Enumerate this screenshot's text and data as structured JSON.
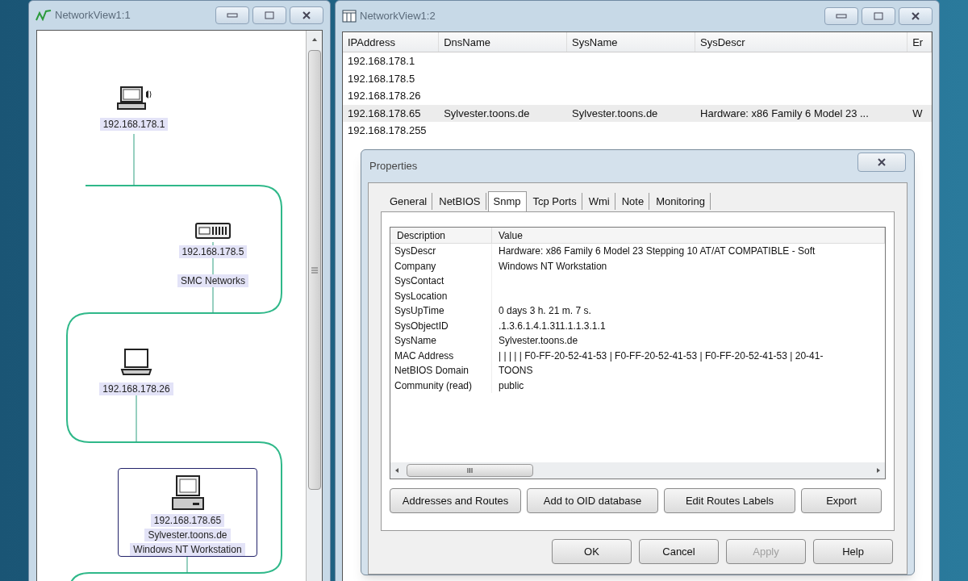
{
  "topology_window": {
    "title": "NetworkView1:1",
    "nodes": [
      {
        "kind": "workstation",
        "labels": [
          "192.168.178.1"
        ],
        "selected": false
      },
      {
        "kind": "router",
        "labels": [
          "192.168.178.5",
          "SMC Networks"
        ],
        "selected": false
      },
      {
        "kind": "laptop",
        "labels": [
          "192.168.178.26"
        ],
        "selected": false
      },
      {
        "kind": "desktop",
        "labels": [
          "192.168.178.65",
          "Sylvester.toons.de",
          "Windows NT Workstation"
        ],
        "selected": true
      }
    ]
  },
  "table_window": {
    "title": "NetworkView1:2",
    "columns": [
      "IPAddress",
      "DnsName",
      "SysName",
      "SysDescr",
      "Er"
    ],
    "rows": [
      {
        "cells": [
          "192.168.178.1",
          "",
          "",
          "",
          ""
        ],
        "selected": false
      },
      {
        "cells": [
          "192.168.178.5",
          "",
          "",
          "",
          ""
        ],
        "selected": false
      },
      {
        "cells": [
          "192.168.178.26",
          "",
          "",
          "",
          ""
        ],
        "selected": false
      },
      {
        "cells": [
          "192.168.178.65",
          "Sylvester.toons.de",
          "Sylvester.toons.de",
          "Hardware: x86 Family 6 Model 23 ...",
          "W"
        ],
        "selected": true
      },
      {
        "cells": [
          "192.168.178.255",
          "",
          "",
          "",
          ""
        ],
        "selected": false
      }
    ]
  },
  "properties_dialog": {
    "title": "Properties",
    "tabs": [
      {
        "label": "General",
        "selected": false
      },
      {
        "label": "NetBIOS",
        "selected": false
      },
      {
        "label": "Snmp",
        "selected": true
      },
      {
        "label": "Tcp Ports",
        "selected": false
      },
      {
        "label": "Wmi",
        "selected": false
      },
      {
        "label": "Note",
        "selected": false
      },
      {
        "label": "Monitoring",
        "selected": false
      }
    ],
    "columns": [
      "Description",
      "Value"
    ],
    "rows": [
      [
        "SysDescr",
        "Hardware: x86 Family 6 Model 23 Stepping 10 AT/AT COMPATIBLE - Soft"
      ],
      [
        "Company",
        "Windows NT Workstation"
      ],
      [
        "SysContact",
        ""
      ],
      [
        "SysLocation",
        ""
      ],
      [
        "SysUpTime",
        "0 days 3 h. 21 m. 7 s."
      ],
      [
        "SysObjectID",
        ".1.3.6.1.4.1.311.1.1.3.1.1"
      ],
      [
        "SysName",
        "Sylvester.toons.de"
      ],
      [
        "MAC Address",
        "| | | | | F0-FF-20-52-41-53 | F0-FF-20-52-41-53 | F0-FF-20-52-41-53 | 20-41-"
      ],
      [
        "NetBIOS Domain",
        "TOONS"
      ],
      [
        "Community (read)",
        "public"
      ]
    ],
    "scroll_grip": "III",
    "action_buttons": [
      "Addresses and Routes",
      "Add to OID database",
      "Edit Routes Labels",
      "Export"
    ],
    "dialog_buttons": [
      {
        "label": "OK",
        "disabled": false
      },
      {
        "label": "Cancel",
        "disabled": false
      },
      {
        "label": "Apply",
        "disabled": true
      },
      {
        "label": "Help",
        "disabled": false
      }
    ]
  }
}
